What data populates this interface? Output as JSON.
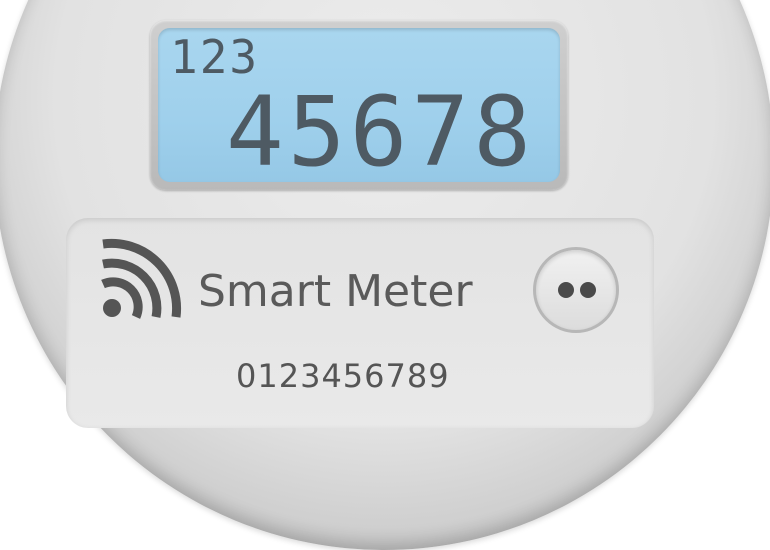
{
  "display": {
    "top_line": "123",
    "main_reading": "45678"
  },
  "label": {
    "brand": "Smart Meter",
    "serial_number": "0123456789"
  },
  "icons": {
    "signal": "wireless-signal-icon",
    "port": "optical-port-icon"
  },
  "colors": {
    "lcd_background": "#9fd0ec",
    "lcd_text": "#4e5a63",
    "body": "#e2e2e2",
    "label_text": "#5a5a5a"
  }
}
